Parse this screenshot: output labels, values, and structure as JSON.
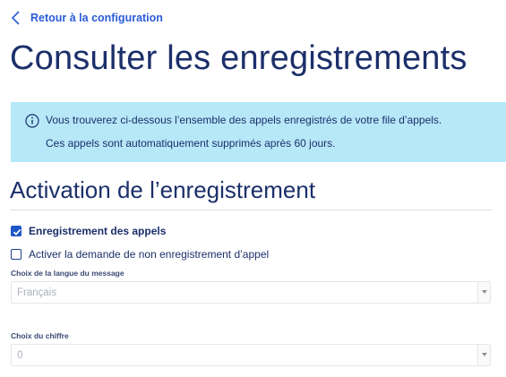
{
  "back_link": {
    "label": "Retour à la configuration",
    "icon": "chevron-left-icon"
  },
  "page_title": "Consulter les enregistrements",
  "info_banner": {
    "icon": "info-icon",
    "line1": "Vous trouverez ci-dessous l’ensemble des appels enregistrés de votre file d’appels.",
    "line2": "Ces appels sont automatiquement supprimés après 60 jours.",
    "background_color": "#b6e8f8"
  },
  "section": {
    "title": "Activation de l’enregistrement",
    "checkboxes": [
      {
        "label": "Enregistrement des appels",
        "checked": true
      },
      {
        "label": "Activer la demande de non enregistrement d’appel",
        "checked": false
      }
    ],
    "fields": [
      {
        "label": "Choix de la langue du message",
        "value": "Français",
        "disabled": true
      },
      {
        "label": "Choix du chiffre",
        "value": "0",
        "disabled": true
      }
    ]
  },
  "colors": {
    "title": "#1b2f6a",
    "link": "#2a5bd7",
    "checkbox_checked": "#1e56c8"
  }
}
